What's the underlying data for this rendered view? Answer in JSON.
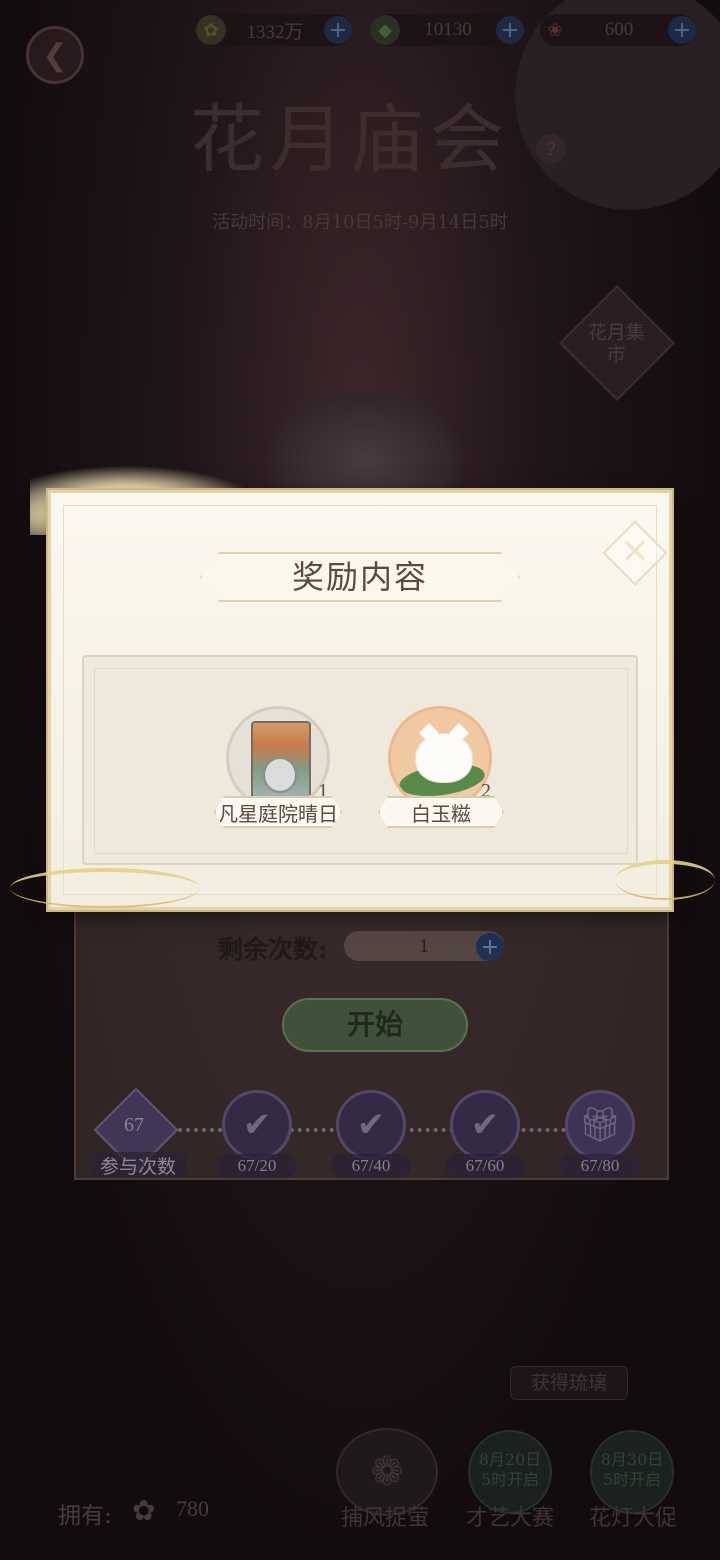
{
  "top_bar": {
    "back_icon": "back-arrow-icon",
    "resources": [
      {
        "icon": "coin-icon",
        "value": "1332万"
      },
      {
        "icon": "gem-icon",
        "value": "10130"
      },
      {
        "icon": "flower-ticket-icon",
        "value": "600"
      }
    ],
    "plus_glyph": "+"
  },
  "event": {
    "title": "花月庙会",
    "time": "活动时间：8月10日5时-9月14日5时",
    "market_label": "花月集市"
  },
  "panel": {
    "remaining_label": "剩余次数:",
    "remaining_value": "1",
    "start_label": "开始",
    "participation_count": "67",
    "participation_label": "参与次数",
    "milestones": [
      {
        "label": "67/20",
        "state": "claimed",
        "icon": "checkmark-icon"
      },
      {
        "label": "67/40",
        "state": "claimed",
        "icon": "checkmark-icon"
      },
      {
        "label": "67/60",
        "state": "claimed",
        "icon": "checkmark-icon"
      },
      {
        "label": "67/80",
        "state": "locked",
        "icon": "gift-icon"
      }
    ]
  },
  "bottom": {
    "own_label": "拥有:",
    "own_value": "780",
    "obtain_label": "获得琉璃",
    "catch_label": "捕风捉萤",
    "talent_label": "才艺大赛",
    "talent_open": "8月20日\n5时开启",
    "lantern_label": "花灯大促",
    "lantern_open": "8月30日\n5时开启"
  },
  "modal": {
    "title": "奖励内容",
    "close_icon": "close-icon",
    "rewards": [
      {
        "name": "凡星庭院晴日",
        "qty": "1",
        "icon": "courtyard-card-icon"
      },
      {
        "name": "白玉糍",
        "qty": "2",
        "icon": "rice-cake-icon"
      }
    ]
  },
  "colors": {
    "modal_bg": "#f5f0e4",
    "gold_trim": "#e2d4a6",
    "title_text": "#5a4a40",
    "plus_blue": "#2a4a80"
  }
}
